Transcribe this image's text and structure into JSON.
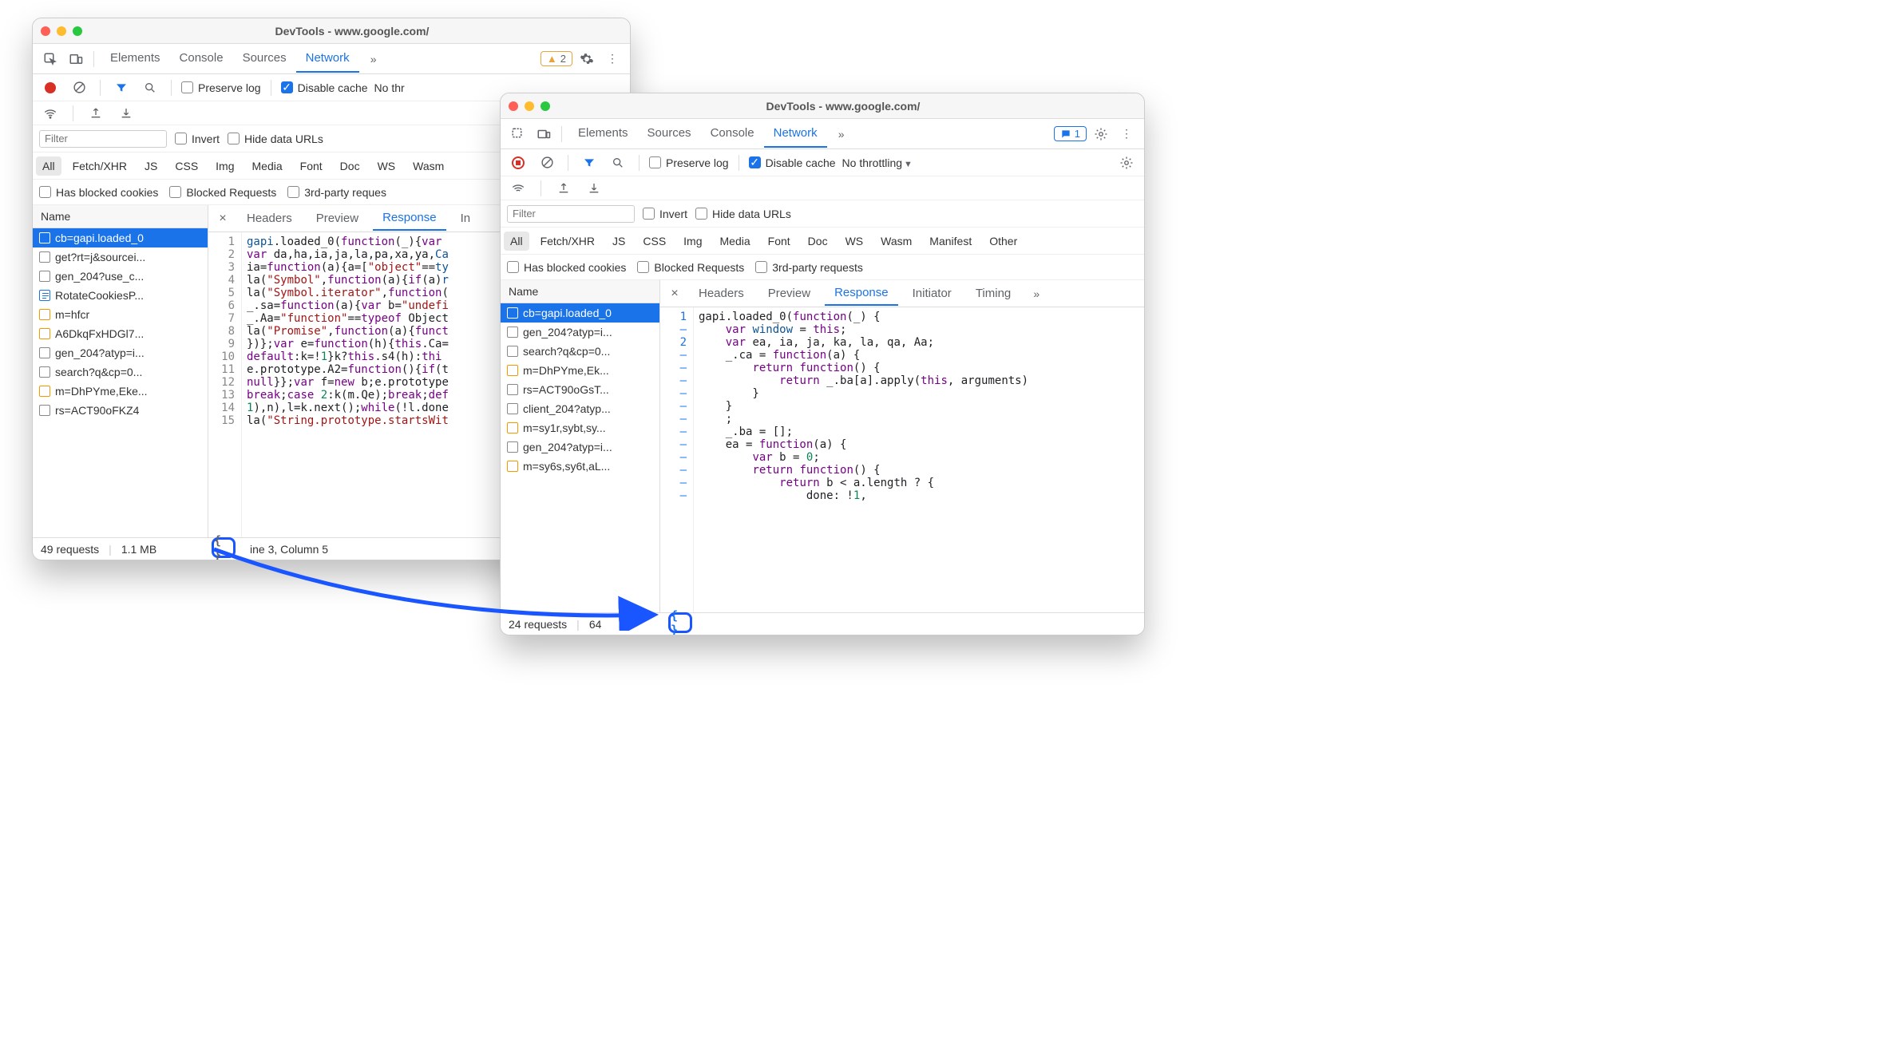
{
  "windowA": {
    "title": "DevTools - www.google.com/",
    "mainTabs": [
      "Elements",
      "Console",
      "Sources",
      "Network"
    ],
    "activeMainTab": "Network",
    "warningBadge": "2",
    "tb2": {
      "preserve": "Preserve log",
      "disable": "Disable cache",
      "throttling": "No thr"
    },
    "filter": {
      "placeholder": "Filter",
      "invert": "Invert",
      "hide": "Hide data URLs"
    },
    "typePills": [
      "All",
      "Fetch/XHR",
      "JS",
      "CSS",
      "Img",
      "Media",
      "Font",
      "Doc",
      "WS",
      "Wasm"
    ],
    "checks": {
      "blocked": "Has blocked cookies",
      "breq": "Blocked Requests",
      "third": "3rd-party reques"
    },
    "nameHeader": "Name",
    "requests": [
      {
        "label": "cb=gapi.loaded_0",
        "icon": "orange",
        "sel": true
      },
      {
        "label": "get?rt=j&sourcei...",
        "icon": "plain"
      },
      {
        "label": "gen_204?use_c...",
        "icon": "plain"
      },
      {
        "label": "RotateCookiesP...",
        "icon": "blue-doc"
      },
      {
        "label": "m=hfcr",
        "icon": "orange"
      },
      {
        "label": "A6DkqFxHDGl7...",
        "icon": "orange"
      },
      {
        "label": "gen_204?atyp=i...",
        "icon": "plain"
      },
      {
        "label": "search?q&cp=0...",
        "icon": "plain"
      },
      {
        "label": "m=DhPYme,Eke...",
        "icon": "orange"
      },
      {
        "label": "rs=ACT90oFKZ4",
        "icon": "plain"
      }
    ],
    "detailTabs": [
      "Headers",
      "Preview",
      "Response",
      "In"
    ],
    "activeDetail": "Response",
    "code": {
      "lines": [
        "1",
        "2",
        "3",
        "4",
        "5",
        "6",
        "7",
        "8",
        "9",
        "10",
        "11",
        "12",
        "13",
        "14",
        "15"
      ]
    },
    "status": {
      "reqs": "49 requests",
      "size": "1.1 MB",
      "cursor": "ine 3, Column 5"
    }
  },
  "windowB": {
    "title": "DevTools - www.google.com/",
    "mainTabs": [
      "Elements",
      "Sources",
      "Console",
      "Network"
    ],
    "activeMainTab": "Network",
    "msgBadge": "1",
    "tb2": {
      "preserve": "Preserve log",
      "disable": "Disable cache",
      "throttling": "No throttling"
    },
    "filter": {
      "placeholder": "Filter",
      "invert": "Invert",
      "hide": "Hide data URLs"
    },
    "typePills": [
      "All",
      "Fetch/XHR",
      "JS",
      "CSS",
      "Img",
      "Media",
      "Font",
      "Doc",
      "WS",
      "Wasm",
      "Manifest",
      "Other"
    ],
    "checks": {
      "blocked": "Has blocked cookies",
      "breq": "Blocked Requests",
      "third": "3rd-party requests"
    },
    "nameHeader": "Name",
    "requests": [
      {
        "label": "cb=gapi.loaded_0",
        "icon": "orange",
        "sel": true
      },
      {
        "label": "gen_204?atyp=i...",
        "icon": "plain"
      },
      {
        "label": "search?q&cp=0...",
        "icon": "plain"
      },
      {
        "label": "m=DhPYme,Ek...",
        "icon": "orange"
      },
      {
        "label": "rs=ACT90oGsT...",
        "icon": "plain"
      },
      {
        "label": "client_204?atyp...",
        "icon": "plain"
      },
      {
        "label": "m=sy1r,sybt,sy...",
        "icon": "orange"
      },
      {
        "label": "gen_204?atyp=i...",
        "icon": "plain"
      },
      {
        "label": "m=sy6s,sy6t,aL...",
        "icon": "orange"
      }
    ],
    "detailTabs": [
      "Headers",
      "Preview",
      "Response",
      "Initiator",
      "Timing"
    ],
    "activeDetail": "Response",
    "gutterLines": [
      "1",
      "–",
      "2",
      "–",
      "–",
      "–",
      "–",
      "–",
      "–",
      "–",
      "–",
      "–",
      "–",
      "–",
      "–"
    ],
    "status": {
      "reqs": "24 requests",
      "size": "64"
    }
  }
}
